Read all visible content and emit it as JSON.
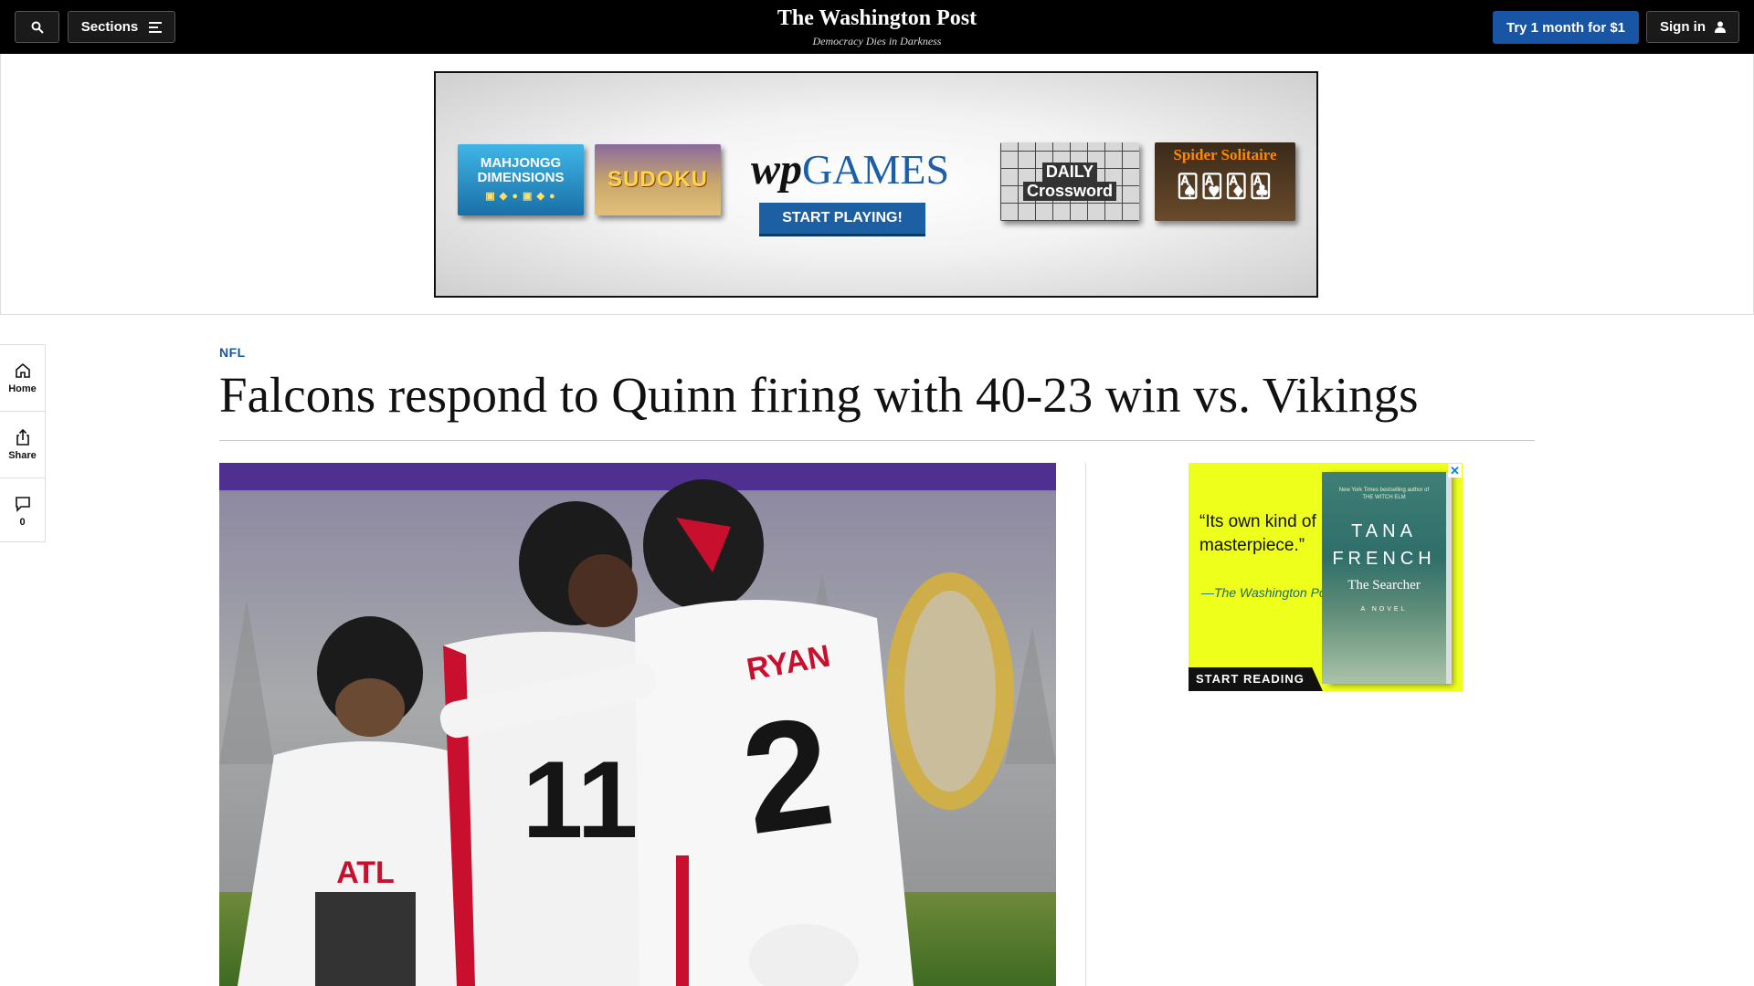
{
  "header": {
    "search_label": "",
    "sections_label": "Sections",
    "masthead": "The Washington Post",
    "tagline": "Democracy Dies in Darkness",
    "subscribe_label": "Try 1 month for $1",
    "signin_label": "Sign in"
  },
  "top_ad": {
    "tiles": {
      "mahjongg": "MAHJONGG DIMENSIONS",
      "sudoku": "SUDOKU",
      "crossword_line1": "DAILY",
      "crossword_line2": "Crossword",
      "spider": "Spider Solitaire"
    },
    "brand_wp": "wp",
    "brand_games": "GAMES",
    "cta": "START PLAYING!"
  },
  "rail": {
    "home": "Home",
    "share": "Share",
    "comments": "0"
  },
  "article": {
    "kicker": "NFL",
    "headline": "Falcons respond to Quinn firing with 40-23 win vs. Vikings"
  },
  "photo": {
    "jersey_ryan_name": "RYAN",
    "jersey_ryan_number": "2",
    "jersey_11": "11",
    "jersey_atl": "ATL"
  },
  "book_ad": {
    "quote": "“Its own kind of masterpiece.”",
    "attribution": "—The Washington Post",
    "cover_blurb": "New York Times bestselling author of THE WITCH ELM",
    "author": "TANA FRENCH",
    "title": "The Searcher",
    "novel_label": "A NOVEL",
    "cta": "START READING",
    "close": "✕"
  },
  "colors": {
    "nav_bg": "#000000",
    "accent_blue": "#1955a5",
    "ad_yellow": "#efff1c"
  }
}
